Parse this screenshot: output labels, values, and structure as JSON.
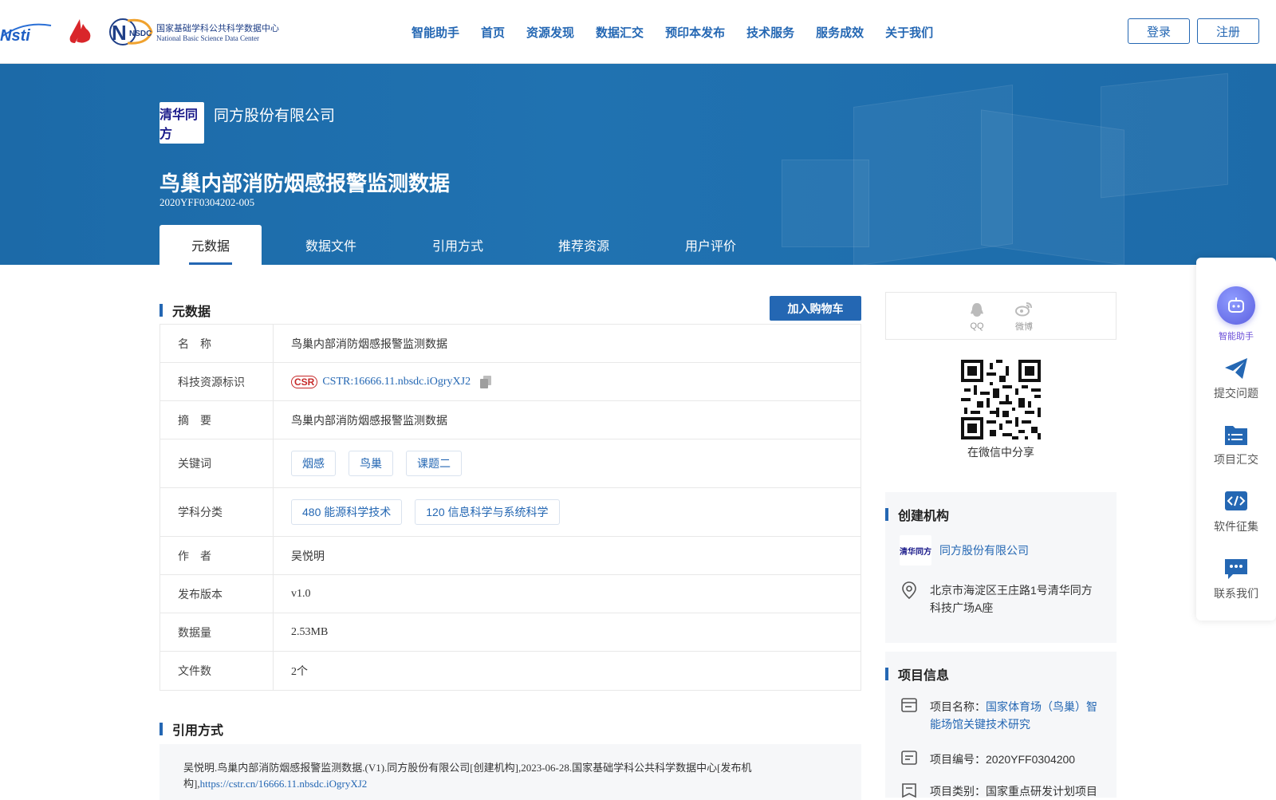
{
  "header": {
    "logos": {
      "nstl": "Nsti",
      "nsdc_short": "NSDC",
      "nsdc_cn": "国家基础学科公共科学数据中心",
      "nsdc_en": "National Basic Science Data Center"
    },
    "nav": [
      "智能助手",
      "首页",
      "资源发现",
      "数据汇交",
      "预印本发布",
      "技术服务",
      "服务成效",
      "关于我们"
    ],
    "login_label": "登录",
    "register_label": "注册"
  },
  "banner": {
    "org_logo_text": "清华同方",
    "org_name": "同方股份有限公司",
    "title": "鸟巢内部消防烟感报警监测数据",
    "code": "2020YFF0304202-005",
    "tabs": [
      "元数据",
      "数据文件",
      "引用方式",
      "推荐资源",
      "用户评价"
    ],
    "active_tab": "元数据"
  },
  "metadata": {
    "section_title": "元数据",
    "cart_label": "加入购物车",
    "rows": {
      "name": {
        "key": "名　称",
        "value": "鸟巢内部消防烟感报警监测数据"
      },
      "cstr": {
        "key": "科技资源标识",
        "badge": "CSR",
        "value": "CSTR:16666.11.nbsdc.iOgryXJ2"
      },
      "abstract": {
        "key": "摘　要",
        "value": "鸟巢内部消防烟感报警监测数据"
      },
      "keywords": {
        "key": "关键词",
        "tags": [
          "烟感",
          "鸟巢",
          "课题二"
        ]
      },
      "subjects": {
        "key": "学科分类",
        "tags": [
          "480 能源科学技术",
          "120 信息科学与系统科学"
        ]
      },
      "author": {
        "key": "作　者",
        "value": "吴悦明"
      },
      "version": {
        "key": "发布版本",
        "value": "v1.0"
      },
      "size": {
        "key": "数据量",
        "value": "2.53MB"
      },
      "files": {
        "key": "文件数",
        "value": "2个"
      }
    }
  },
  "citation": {
    "section_title": "引用方式",
    "text": "吴悦明.鸟巢内部消防烟感报警监测数据.(V1).同方股份有限公司[创建机构],2023-06-28.国家基础学科公共科学数据中心[发布机构],",
    "link": "https://cstr.cn/16666.11.nbsdc.iOgryXJ2"
  },
  "share": {
    "qq_label": "QQ",
    "weibo_label": "微博",
    "wechat_caption": "在微信中分享"
  },
  "creator": {
    "section_title": "创建机构",
    "org_logo_text": "清华同方",
    "org_name": "同方股份有限公司",
    "address": "北京市海淀区王庄路1号清华同方科技广场A座"
  },
  "project": {
    "section_title": "项目信息",
    "name_label": "项目名称：",
    "name_value": "国家体育场（鸟巢）智能场馆关键技术研究",
    "id_label": "项目编号：",
    "id_value": "2020YFF0304200",
    "type_label": "项目类别：",
    "type_value": "国家重点研发计划项目"
  },
  "float_bar": {
    "ai": "智能助手",
    "submit": "提交问题",
    "project": "项目汇交",
    "software": "软件征集",
    "contact": "联系我们"
  },
  "colors": {
    "brand": "#2467b3",
    "banner": "#1f6fae",
    "ai": "#5b5fe0"
  }
}
